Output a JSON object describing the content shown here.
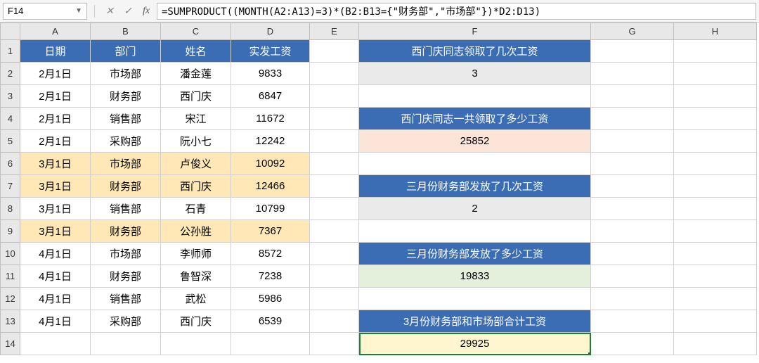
{
  "nameBox": "F14",
  "formula": "=SUMPRODUCT((MONTH(A2:A13)=3)*(B2:B13={\"财务部\",\"市场部\"})*D2:D13)",
  "columns": [
    "A",
    "B",
    "C",
    "D",
    "E",
    "F",
    "G",
    "H"
  ],
  "header": {
    "date": "日期",
    "dept": "部门",
    "name": "姓名",
    "salary": "实发工资"
  },
  "rows": [
    {
      "date": "2月1日",
      "dept": "市场部",
      "name": "潘金莲",
      "salary": "9833"
    },
    {
      "date": "2月1日",
      "dept": "财务部",
      "name": "西门庆",
      "salary": "6847"
    },
    {
      "date": "2月1日",
      "dept": "销售部",
      "name": "宋江",
      "salary": "11672"
    },
    {
      "date": "2月1日",
      "dept": "采购部",
      "name": "阮小七",
      "salary": "12242"
    },
    {
      "date": "3月1日",
      "dept": "市场部",
      "name": "卢俊义",
      "salary": "10092",
      "hl": true
    },
    {
      "date": "3月1日",
      "dept": "财务部",
      "name": "西门庆",
      "salary": "12466",
      "hl": true
    },
    {
      "date": "3月1日",
      "dept": "销售部",
      "name": "石青",
      "salary": "10799"
    },
    {
      "date": "3月1日",
      "dept": "财务部",
      "name": "公孙胜",
      "salary": "7367",
      "hl": true
    },
    {
      "date": "4月1日",
      "dept": "市场部",
      "name": "李师师",
      "salary": "8572"
    },
    {
      "date": "4月1日",
      "dept": "财务部",
      "name": "鲁智深",
      "salary": "7238"
    },
    {
      "date": "4月1日",
      "dept": "销售部",
      "name": "武松",
      "salary": "5986"
    },
    {
      "date": "4月1日",
      "dept": "采购部",
      "name": "西门庆",
      "salary": "6539"
    }
  ],
  "side": {
    "q1": "西门庆同志领取了几次工资",
    "a1": "3",
    "q2": "西门庆同志一共领取了多少工资",
    "a2": "25852",
    "q3": "三月份财务部发放了几次工资",
    "a3": "2",
    "q4": "三月份财务部发放了多少工资",
    "a4": "19833",
    "q5": "3月份财务部和市场部合计工资",
    "a5": "29925"
  }
}
